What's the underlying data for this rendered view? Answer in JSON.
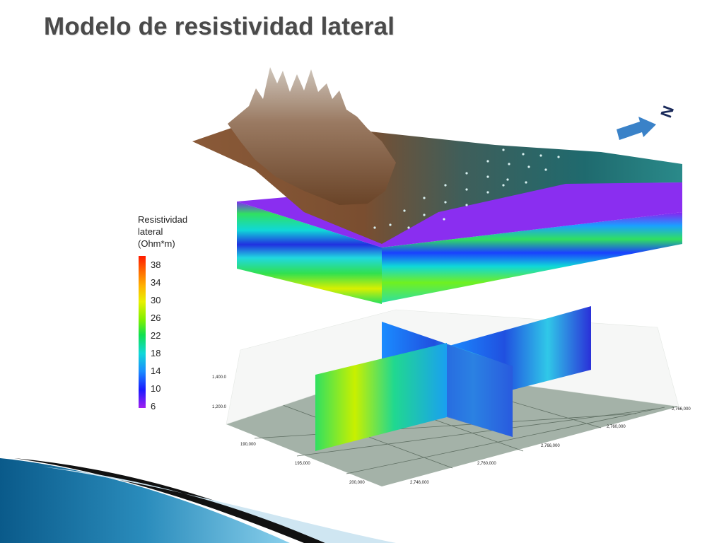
{
  "title": "Modelo de resistividad lateral",
  "legend": {
    "title_lines": [
      "Resistividad",
      "lateral",
      "(Ohm*m)"
    ],
    "values": [
      "38",
      "34",
      "30",
      "26",
      "22",
      "18",
      "14",
      "10",
      "6"
    ]
  },
  "north_label": "N",
  "axis_ticks": {
    "z": [
      "1,400.0",
      "1,200.0"
    ],
    "x": [
      "190,000",
      "195,000",
      "200,000"
    ],
    "y": [
      "2,746,000",
      "2,760,000",
      "2,766,000",
      "2,760,000",
      "2,766,000"
    ]
  }
}
